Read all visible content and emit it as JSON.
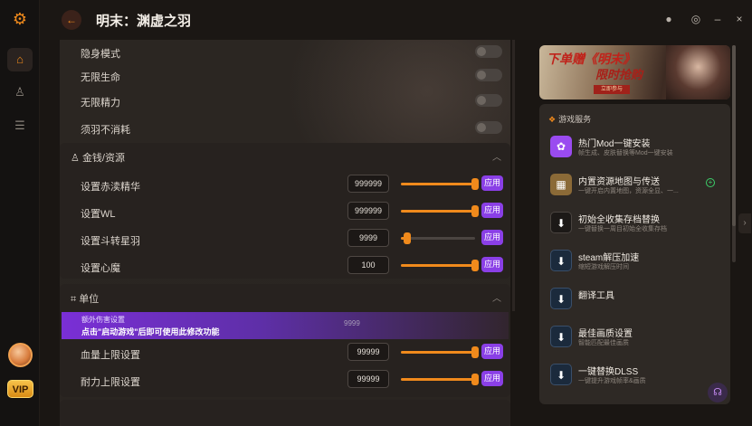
{
  "header": {
    "back_label": "←",
    "title": "明末：渊虚之羽",
    "controls": [
      "●",
      "◎",
      "–",
      "×"
    ]
  },
  "sidebar": {
    "logo": "⚙",
    "items": [
      {
        "name": "home",
        "glyph": "⌂",
        "active": true
      },
      {
        "name": "games",
        "glyph": "♙",
        "active": false
      },
      {
        "name": "library",
        "glyph": "☰",
        "active": false
      }
    ],
    "vip_label": "VIP"
  },
  "toggles": [
    {
      "label": "隐身模式"
    },
    {
      "label": "无限生命"
    },
    {
      "label": "无限精力"
    },
    {
      "label": "须羽不消耗"
    }
  ],
  "money_section": {
    "icon": "♙",
    "title": "金钱/资源",
    "rows": [
      {
        "label": "设置赤渎精华",
        "value": "999999",
        "level": 1.0,
        "apply": "应用"
      },
      {
        "label": "设置WL",
        "value": "999999",
        "level": 1.0,
        "apply": "应用"
      },
      {
        "label": "设置斗转星羽",
        "value": "9999",
        "level": 0.08,
        "apply": "应用"
      },
      {
        "label": "设置心魔",
        "value": "100",
        "level": 1.0,
        "apply": "应用"
      }
    ]
  },
  "unit_section": {
    "icon": "⌗",
    "title": "单位",
    "notice_line1": "额外伤害设置",
    "notice_line2": "点击\"启动游戏\"后即可使用此修改功能",
    "notice_ghost": "9999",
    "rows": [
      {
        "label": "血量上限设置",
        "value": "99999",
        "level": 1.0,
        "apply": "应用"
      },
      {
        "label": "耐力上限设置",
        "value": "99999",
        "level": 1.0,
        "apply": "应用"
      }
    ]
  },
  "banner": {
    "line1": "下单赠《明末》",
    "line2": "限时抢购",
    "tag": "立即参与"
  },
  "services": {
    "title": "游戏服务",
    "items": [
      {
        "name": "热门Mod一键安装",
        "desc": "帧生成、皮肤替换等Mod一键安装",
        "glyph": "✿",
        "style": "purple"
      },
      {
        "name": "内置资源地图与传送",
        "desc": "一键开启内置地图，资源全显、一...",
        "glyph": "▦",
        "style": "gold",
        "plus": "+"
      },
      {
        "name": "初始全收集存档替换",
        "desc": "一键替换一周目初始全收集存档",
        "glyph": "⬇",
        "style": "dark"
      },
      {
        "name": "steam解压加速",
        "desc": "缩短游戏解压时间",
        "glyph": "⬇",
        "style": "blue"
      },
      {
        "name": "翻译工具",
        "desc": "",
        "glyph": "⬇",
        "style": "blue"
      },
      {
        "name": "最佳画质设置",
        "desc": "智能匹配最佳画质",
        "glyph": "⬇",
        "style": "blue"
      },
      {
        "name": "一键替换DLSS",
        "desc": "一键提升游戏帧率&画质",
        "glyph": "⬇",
        "style": "blue"
      }
    ]
  },
  "edge_tab": "›",
  "support_glyph": "☊"
}
